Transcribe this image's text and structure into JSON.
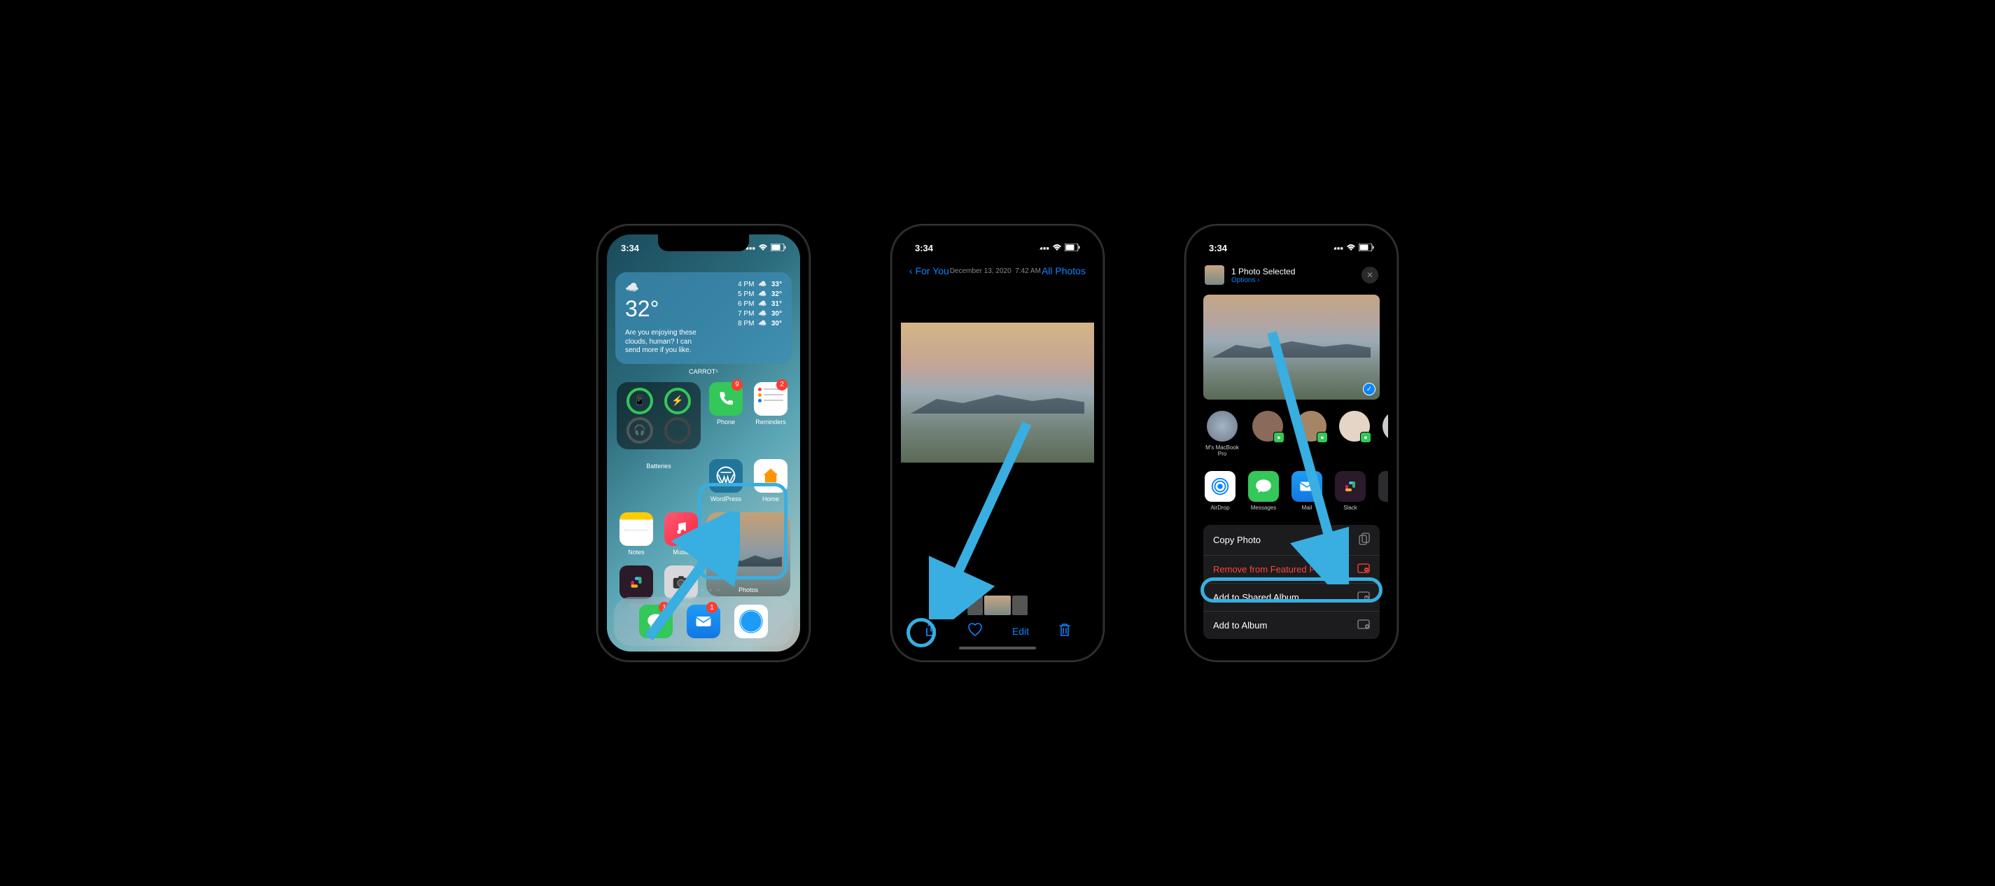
{
  "status": {
    "time": "3:34",
    "location_arrow": "➤"
  },
  "phone1": {
    "weather": {
      "temp": "32°",
      "msg": "Are you enjoying these clouds, human? I can send more if you like.",
      "brand": "CARROT⁵",
      "forecast": [
        {
          "t": "4 PM",
          "hi": "33°"
        },
        {
          "t": "5 PM",
          "hi": "32°"
        },
        {
          "t": "6 PM",
          "hi": "31°"
        },
        {
          "t": "7 PM",
          "hi": "30°"
        },
        {
          "t": "8 PM",
          "hi": "30°"
        }
      ]
    },
    "apps": {
      "batteries": "Batteries",
      "phone": "Phone",
      "phone_badge": "9",
      "reminders": "Reminders",
      "reminders_badge": "2",
      "wordpress": "WordPress",
      "home": "Home",
      "notes": "Notes",
      "music": "Music",
      "photos": "Photos",
      "slack": "Slack",
      "camera": "Camera"
    },
    "dock": {
      "messages_badge": "1",
      "mail_badge": "1"
    }
  },
  "phone2": {
    "back": "For You",
    "date": "December 13, 2020",
    "time": "7:42 AM",
    "all": "All Photos",
    "edit": "Edit"
  },
  "phone3": {
    "title": "1 Photo Selected",
    "options": "Options",
    "contacts": {
      "macbook": "M's MacBook Pro"
    },
    "share_apps": {
      "airdrop": "AirDrop",
      "messages": "Messages",
      "mail": "Mail",
      "slack": "Slack"
    },
    "actions": {
      "copy": "Copy Photo",
      "remove": "Remove from Featured Photos",
      "shared": "Add to Shared Album",
      "album": "Add to Album"
    }
  }
}
